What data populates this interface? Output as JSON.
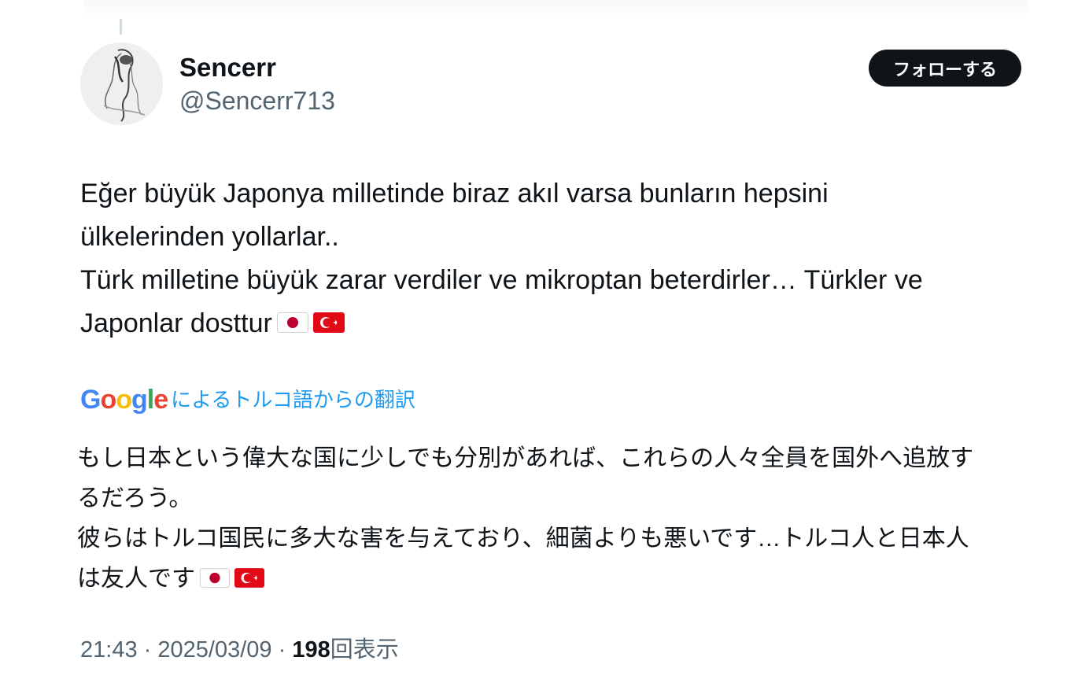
{
  "author": {
    "name": "Sencerr",
    "handle": "@Sencerr713"
  },
  "follow_button_label": "フォローする",
  "tweet": {
    "lines": [
      "Eğer büyük Japonya milletinde biraz akıl varsa bunların hepsini",
      "ülkelerinden yollarlar..",
      "Türk milletine büyük zarar verdiler ve mikroptan beterdirler… Türkler ve",
      "Japonlar dosttur"
    ]
  },
  "translation": {
    "provider_logo": "Google",
    "label": "によるトルコ語からの翻訳",
    "lines": [
      "もし日本という偉大な国に少しでも分別があれば、これらの人々全員を国外へ追放す",
      "るだろう。",
      "彼らはトルコ国民に多大な害を与えており、細菌よりも悪いです…トルコ人と日本人",
      "は友人です"
    ]
  },
  "meta": {
    "time": "21:43",
    "separator": "·",
    "date": "2025/03/09",
    "views_count": "198",
    "views_label": "回表示"
  },
  "icons": [
    "japan-flag-icon",
    "turkey-flag-icon",
    "google-logo"
  ],
  "colors": {
    "text": "#0f1419",
    "secondary": "#536471",
    "link": "#1d9bf0",
    "button_bg": "#0f1419",
    "flag_red": "#e30a17",
    "japan_red": "#bc002d"
  }
}
